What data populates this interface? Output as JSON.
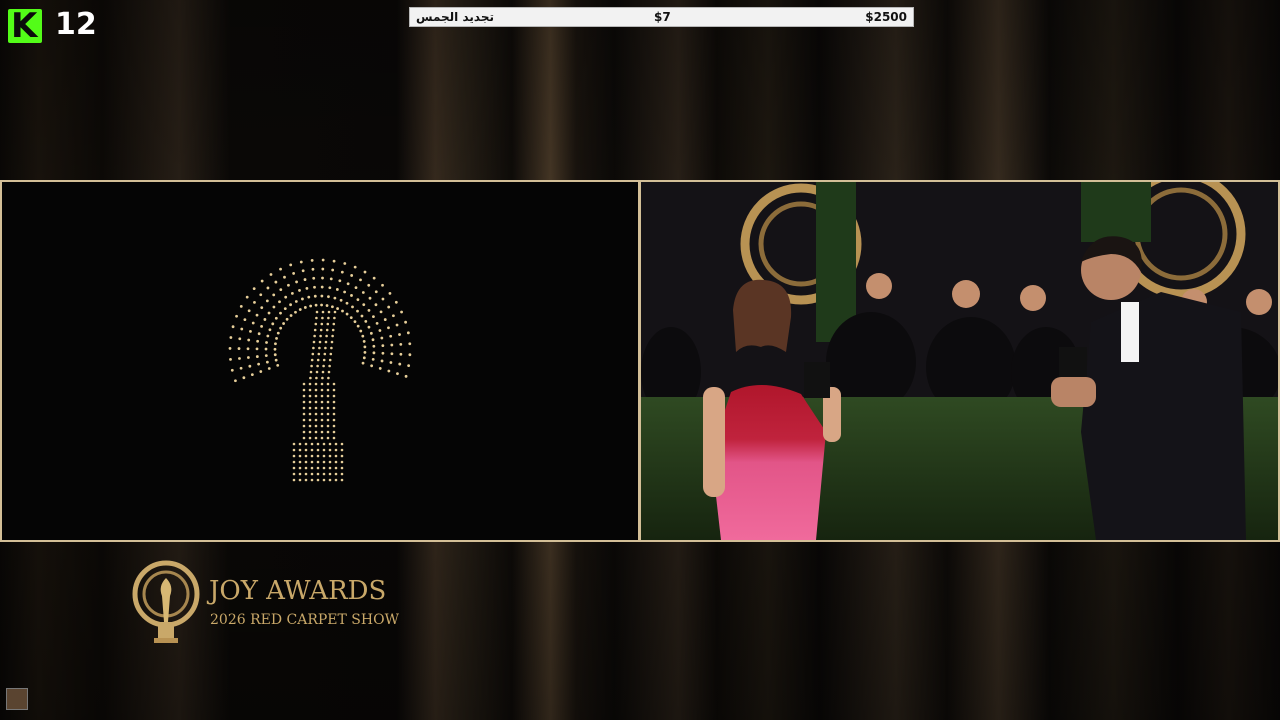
{
  "platform": {
    "logo_letter": "K",
    "viewer_count": "12"
  },
  "ticker": {
    "item_name": "تجديد الجمس",
    "price": "$7",
    "goal": "$2500"
  },
  "event": {
    "title": "JOY AWARDS",
    "subtitle": "2026 RED CARPET SHOW"
  },
  "icons": [
    "kick-logo-icon",
    "trophy-logo-icon",
    "drone-trophy-formation",
    "streamer-avatar-icon"
  ],
  "colors": {
    "kick_green": "#53fc18",
    "gold": "#c9a869",
    "frame": "#d3bf97"
  }
}
